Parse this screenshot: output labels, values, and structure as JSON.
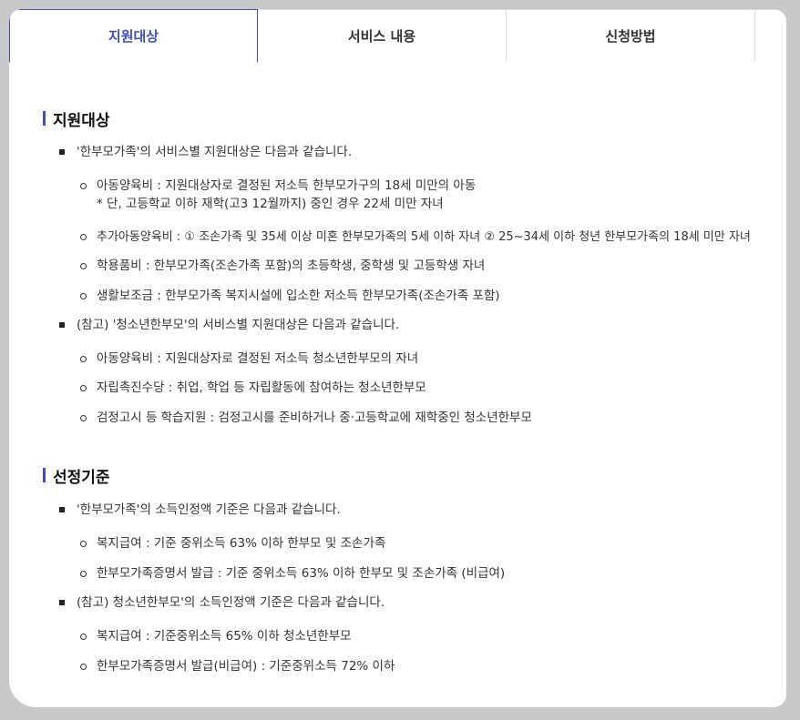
{
  "tabs": [
    {
      "label": "지원대상",
      "active": true
    },
    {
      "label": "서비스 내용",
      "active": false
    },
    {
      "label": "신청방법",
      "active": false
    },
    {
      "label": "",
      "active": false
    }
  ],
  "sections": [
    {
      "title": "지원대상",
      "groups": [
        {
          "text": "'한부모가족'의 서비스별 지원대상은 다음과 같습니다.",
          "items": [
            {
              "text": "아동양육비 : 지원대상자로 결정된 저소득 한부모가구의 18세 미만의 아동",
              "note": "* 단, 고등학교 이하 재학(고3 12월까지) 중인 경우 22세 미만 자녀"
            },
            {
              "text": "추가아동양육비 : ① 조손가족 및 35세 이상 미혼 한부모가족의 5세 이하 자녀 ② 25~34세 이하 청년 한부모가족의 18세 미만 자녀"
            },
            {
              "text": "학용품비 : 한부모가족(조손가족 포함)의 초등학생, 중학생 및 고등학생 자녀"
            },
            {
              "text": "생활보조금 : 한부모가족 복지시설에 입소한 저소득 한부모가족(조손가족 포함)"
            }
          ]
        },
        {
          "text": "(참고) '청소년한부모'의 서비스별 지원대상은 다음과 같습니다.",
          "items": [
            {
              "text": "아동양육비 : 지원대상자로 결정된 저소득 청소년한부모의 자녀"
            },
            {
              "text": "자립촉진수당 : 취업, 학업 등 자립활동에 참여하는 청소년한부모"
            },
            {
              "text": "검정고시 등 학습지원 : 검정고시를 준비하거나 중·고등학교에 재학중인 청소년한부모"
            }
          ]
        }
      ]
    },
    {
      "title": "선정기준",
      "groups": [
        {
          "text": "'한부모가족'의 소득인정액 기준은 다음과 같습니다.",
          "items": [
            {
              "text": "복지급여 : 기준 중위소득 63% 이하 한부모 및 조손가족"
            },
            {
              "text": "한부모가족증명서 발급 : 기준 중위소득 63% 이하 한부모 및 조손가족 (비급여)"
            }
          ]
        },
        {
          "text": "(참고) 청소년한부모'의 소득인정액 기준은 다음과 같습니다.",
          "items": [
            {
              "text": "복지급여 : 기준중위소득 65% 이하 청소년한부모"
            },
            {
              "text": "한부모가족증명서 발급(비급여) : 기준중위소득 72% 이하"
            }
          ]
        }
      ]
    }
  ]
}
